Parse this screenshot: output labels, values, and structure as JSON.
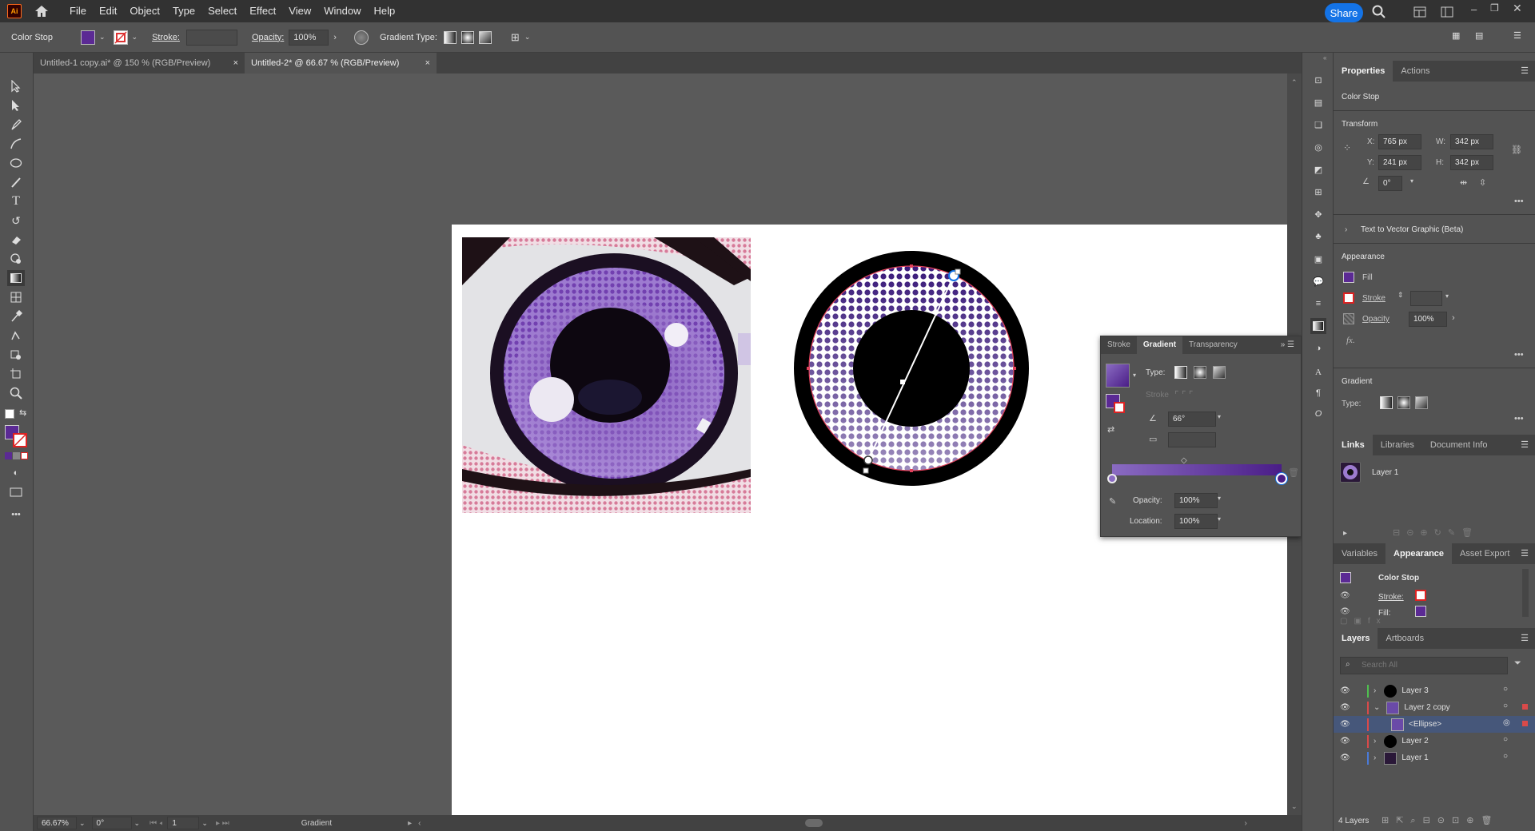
{
  "app": {
    "logo": "Ai"
  },
  "menu": [
    "File",
    "Edit",
    "Object",
    "Type",
    "Select",
    "Effect",
    "View",
    "Window",
    "Help"
  ],
  "share_label": "Share",
  "control_bar": {
    "selection_label": "Color Stop",
    "stroke_label": "Stroke:",
    "opacity_label": "Opacity:",
    "opacity_value": "100%",
    "gradient_type_label": "Gradient Type:"
  },
  "tabs": [
    {
      "label": "Untitled-1 copy.ai* @ 150 % (RGB/Preview)",
      "close": "×"
    },
    {
      "label": "Untitled-2* @ 66.67 % (RGB/Preview)",
      "close": "×"
    }
  ],
  "status": {
    "zoom": "66.67%",
    "rotation": "0°",
    "artboard": "1",
    "tool": "Gradient"
  },
  "gradient_panel": {
    "tabs": [
      "Stroke",
      "Gradient",
      "Transparency"
    ],
    "type_label": "Type:",
    "stroke_label": "Stroke",
    "angle": "66°",
    "opacity_label": "Opacity:",
    "opacity_value": "100%",
    "location_label": "Location:",
    "location_value": "100%",
    "start_color": "#8a6bc2",
    "end_color": "#4a1d87"
  },
  "properties": {
    "tabs": [
      "Properties",
      "Actions"
    ],
    "selection": "Color Stop",
    "transform_title": "Transform",
    "x_label": "X:",
    "x": "765 px",
    "y_label": "Y:",
    "y": "241 px",
    "w_label": "W:",
    "w": "342 px",
    "h_label": "H:",
    "h": "342 px",
    "rotate": "0°",
    "text_to_vector": "Text to Vector Graphic (Beta)",
    "appearance_title": "Appearance",
    "fill_label": "Fill",
    "stroke_label": "Stroke",
    "opacity_label": "Opacity",
    "opacity_value": "100%",
    "fx": "fx.",
    "gradient_title": "Gradient",
    "type_label": "Type:"
  },
  "links_panel": {
    "tabs": [
      "Links",
      "Libraries",
      "Document Info"
    ],
    "item": "Layer 1"
  },
  "appearance_panel": {
    "tabs": [
      "Variables",
      "Appearance",
      "Asset Export"
    ],
    "title": "Color Stop",
    "stroke_label": "Stroke:",
    "fill_label": "Fill:"
  },
  "layers_panel": {
    "tabs": [
      "Layers",
      "Artboards"
    ],
    "search_placeholder": "Search All",
    "rows": [
      {
        "name": "Layer 3",
        "color": "#4fbf4f"
      },
      {
        "name": "Layer 2 copy",
        "color": "#d94a4a"
      },
      {
        "name": "<Ellipse>",
        "color": "#d94a4a"
      },
      {
        "name": "Layer 2",
        "color": "#d94a4a"
      },
      {
        "name": "Layer 1",
        "color": "#4a7ad9"
      }
    ],
    "count": "4 Layers"
  },
  "colors": {
    "accent": "#1473e6",
    "fill": "#5b2a94",
    "selection": "#46577a"
  }
}
